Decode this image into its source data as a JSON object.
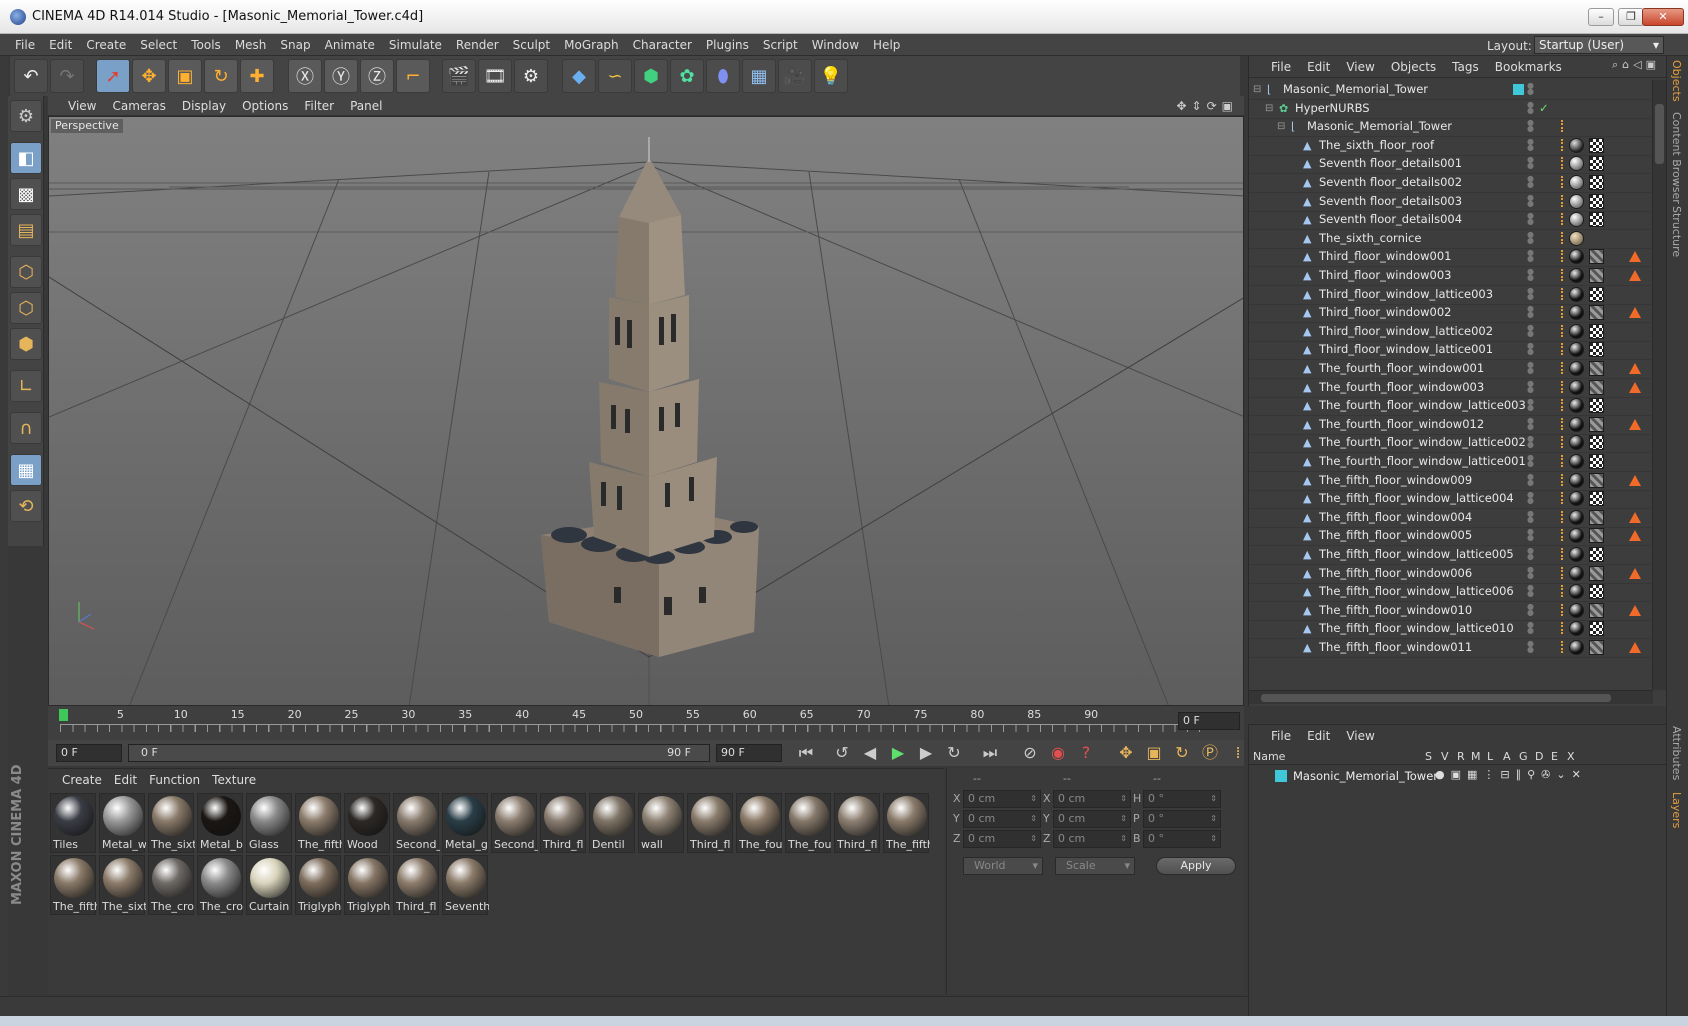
{
  "window": {
    "title": "CINEMA 4D R14.014 Studio - [Masonic_Memorial_Tower.c4d]",
    "buttons": [
      "–",
      "❐",
      "✕"
    ]
  },
  "menubar": [
    "File",
    "Edit",
    "Create",
    "Select",
    "Tools",
    "Mesh",
    "Snap",
    "Animate",
    "Simulate",
    "Render",
    "Sculpt",
    "MoGraph",
    "Character",
    "Plugins",
    "Script",
    "Window",
    "Help"
  ],
  "layout": {
    "label": "Layout:",
    "value": "Startup (User)"
  },
  "viewport": {
    "menu": [
      "View",
      "Cameras",
      "Display",
      "Options",
      "Filter",
      "Panel"
    ],
    "label": "Perspective"
  },
  "timeline": {
    "ticks": [
      "0",
      "5",
      "10",
      "15",
      "20",
      "25",
      "30",
      "35",
      "40",
      "45",
      "50",
      "55",
      "60",
      "65",
      "70",
      "75",
      "80",
      "85",
      "90"
    ],
    "end_frame": "0 F",
    "start": "0 F",
    "range_start": "0 F",
    "range_end": "90 F",
    "max": "90 F"
  },
  "material_manager": {
    "menu": [
      "Create",
      "Edit",
      "Function",
      "Texture"
    ],
    "materials": [
      {
        "name": "Tiles",
        "color": "#3a3d45"
      },
      {
        "name": "Metal_w",
        "color": "#9a9a9a"
      },
      {
        "name": "The_sixt",
        "color": "#8a7a6a"
      },
      {
        "name": "Metal_b",
        "color": "#1a1613"
      },
      {
        "name": "Glass",
        "color": "#8a8a8a"
      },
      {
        "name": "The_fifth",
        "color": "#8c7c6c"
      },
      {
        "name": "Wood",
        "color": "#2c2825"
      },
      {
        "name": "Second_",
        "color": "#8a7c6e"
      },
      {
        "name": "Metal_g",
        "color": "#2a3e48"
      },
      {
        "name": "Second_",
        "color": "#8c7e70"
      },
      {
        "name": "Third_fl",
        "color": "#8a7d70"
      },
      {
        "name": "Dentil",
        "color": "#7f7466"
      },
      {
        "name": "wall",
        "color": "#8e8273"
      },
      {
        "name": "Third_fl",
        "color": "#8a7c6c"
      },
      {
        "name": "The_fou",
        "color": "#8c7b69"
      },
      {
        "name": "The_fou",
        "color": "#857869"
      },
      {
        "name": "Third_fl",
        "color": "#8d8072"
      },
      {
        "name": "The_fifth",
        "color": "#8a7b6b"
      },
      {
        "name": "The_fifth",
        "color": "#8a7a68"
      },
      {
        "name": "The_sixt",
        "color": "#8c7c6a"
      },
      {
        "name": "The_cro:",
        "color": "#6e6a66"
      },
      {
        "name": "The_cro:",
        "color": "#8a8a8a"
      },
      {
        "name": "Curtain",
        "color": "#d8d4bc"
      },
      {
        "name": "Triglyph",
        "color": "#7e6e5e"
      },
      {
        "name": "Triglyph",
        "color": "#857565"
      },
      {
        "name": "Third_fl",
        "color": "#8d7d6d"
      },
      {
        "name": "Seventh",
        "color": "#8a7a68"
      }
    ]
  },
  "brand": "MAXON CINEMA 4D",
  "coordinates": {
    "header": [
      "--",
      "--",
      "--"
    ],
    "rows": [
      {
        "a": "X",
        "av": "0 cm",
        "b": "X",
        "bv": "0 cm",
        "c": "H",
        "cv": "0 °"
      },
      {
        "a": "Y",
        "av": "0 cm",
        "b": "Y",
        "bv": "0 cm",
        "c": "P",
        "cv": "0 °"
      },
      {
        "a": "Z",
        "av": "0 cm",
        "b": "Z",
        "bv": "0 cm",
        "c": "B",
        "cv": "0 °"
      }
    ],
    "world": "World",
    "scale": "Scale",
    "apply": "Apply"
  },
  "object_manager": {
    "menu": [
      "File",
      "Edit",
      "View",
      "Objects",
      "Tags",
      "Bookmarks"
    ],
    "objects": [
      {
        "name": "Masonic_Memorial_Tower",
        "depth": 0,
        "type": "null",
        "tags": []
      },
      {
        "name": "HyperNURBS",
        "depth": 1,
        "type": "nurbs",
        "tags": []
      },
      {
        "name": "Masonic_Memorial_Tower",
        "depth": 2,
        "type": "null",
        "tags": []
      },
      {
        "name": "The_sixth_floor_roof",
        "depth": 3,
        "type": "poly",
        "tags": [
          "ball-dark",
          "checker"
        ]
      },
      {
        "name": "Seventh floor_details001",
        "depth": 3,
        "type": "poly",
        "tags": [
          "ball-grey",
          "checker"
        ]
      },
      {
        "name": "Seventh floor_details002",
        "depth": 3,
        "type": "poly",
        "tags": [
          "ball-grey",
          "checker"
        ]
      },
      {
        "name": "Seventh floor_details003",
        "depth": 3,
        "type": "poly",
        "tags": [
          "ball-grey",
          "checker"
        ]
      },
      {
        "name": "Seventh floor_details004",
        "depth": 3,
        "type": "poly",
        "tags": [
          "ball-grey",
          "checker"
        ]
      },
      {
        "name": "The_sixth_cornice",
        "depth": 3,
        "type": "poly",
        "tags": [
          "ball-tan"
        ]
      },
      {
        "name": "Third_floor_window001",
        "depth": 3,
        "type": "poly",
        "tags": [
          "ball-black",
          "stripe",
          "warn"
        ]
      },
      {
        "name": "Third_floor_window003",
        "depth": 3,
        "type": "poly",
        "tags": [
          "ball-black",
          "stripe",
          "warn"
        ]
      },
      {
        "name": "Third_floor_window_lattice003",
        "depth": 3,
        "type": "poly",
        "tags": [
          "ball-black",
          "checker"
        ]
      },
      {
        "name": "Third_floor_window002",
        "depth": 3,
        "type": "poly",
        "tags": [
          "ball-black",
          "stripe",
          "warn"
        ]
      },
      {
        "name": "Third_floor_window_lattice002",
        "depth": 3,
        "type": "poly",
        "tags": [
          "ball-black",
          "checker"
        ]
      },
      {
        "name": "Third_floor_window_lattice001",
        "depth": 3,
        "type": "poly",
        "tags": [
          "ball-black",
          "checker"
        ]
      },
      {
        "name": "The_fourth_floor_window001",
        "depth": 3,
        "type": "poly",
        "tags": [
          "ball-black",
          "stripe",
          "warn"
        ]
      },
      {
        "name": "The_fourth_floor_window003",
        "depth": 3,
        "type": "poly",
        "tags": [
          "ball-black",
          "stripe",
          "warn"
        ]
      },
      {
        "name": "The_fourth_floor_window_lattice003",
        "depth": 3,
        "type": "poly",
        "tags": [
          "ball-black",
          "checker"
        ]
      },
      {
        "name": "The_fourth_floor_window012",
        "depth": 3,
        "type": "poly",
        "tags": [
          "ball-black",
          "stripe",
          "warn"
        ]
      },
      {
        "name": "The_fourth_floor_window_lattice002",
        "depth": 3,
        "type": "poly",
        "tags": [
          "ball-black",
          "checker"
        ]
      },
      {
        "name": "The_fourth_floor_window_lattice001",
        "depth": 3,
        "type": "poly",
        "tags": [
          "ball-black",
          "checker"
        ]
      },
      {
        "name": "The_fifth_floor_window009",
        "depth": 3,
        "type": "poly",
        "tags": [
          "ball-black",
          "stripe",
          "warn"
        ]
      },
      {
        "name": "The_fifth_floor_window_lattice004",
        "depth": 3,
        "type": "poly",
        "tags": [
          "ball-black",
          "checker"
        ]
      },
      {
        "name": "The_fifth_floor_window004",
        "depth": 3,
        "type": "poly",
        "tags": [
          "ball-black",
          "stripe",
          "warn"
        ]
      },
      {
        "name": "The_fifth_floor_window005",
        "depth": 3,
        "type": "poly",
        "tags": [
          "ball-black",
          "stripe",
          "warn"
        ]
      },
      {
        "name": "The_fifth_floor_window_lattice005",
        "depth": 3,
        "type": "poly",
        "tags": [
          "ball-black",
          "checker"
        ]
      },
      {
        "name": "The_fifth_floor_window006",
        "depth": 3,
        "type": "poly",
        "tags": [
          "ball-black",
          "stripe",
          "warn"
        ]
      },
      {
        "name": "The_fifth_floor_window_lattice006",
        "depth": 3,
        "type": "poly",
        "tags": [
          "ball-black",
          "checker"
        ]
      },
      {
        "name": "The_fifth_floor_window010",
        "depth": 3,
        "type": "poly",
        "tags": [
          "ball-black",
          "stripe",
          "warn"
        ]
      },
      {
        "name": "The_fifth_floor_window_lattice010",
        "depth": 3,
        "type": "poly",
        "tags": [
          "ball-black",
          "checker"
        ]
      },
      {
        "name": "The_fifth_floor_window011",
        "depth": 3,
        "type": "poly",
        "tags": [
          "ball-black",
          "stripe",
          "warn"
        ]
      }
    ]
  },
  "right_tabs": [
    "Objects",
    "Content Browser",
    "Structure",
    "Attributes",
    "Layers"
  ],
  "layer_manager": {
    "menu": [
      "File",
      "Edit",
      "View"
    ],
    "columns": [
      "Name",
      "S",
      "V",
      "R",
      "M",
      "L",
      "A",
      "G",
      "D",
      "E",
      "X"
    ],
    "layers": [
      {
        "name": "Masonic_Memorial_Tower",
        "color": "#3ec8d8"
      }
    ]
  },
  "colors": {
    "accent": "#7aa0c8",
    "play": "#5ee06a",
    "warning": "#f06a2a"
  }
}
